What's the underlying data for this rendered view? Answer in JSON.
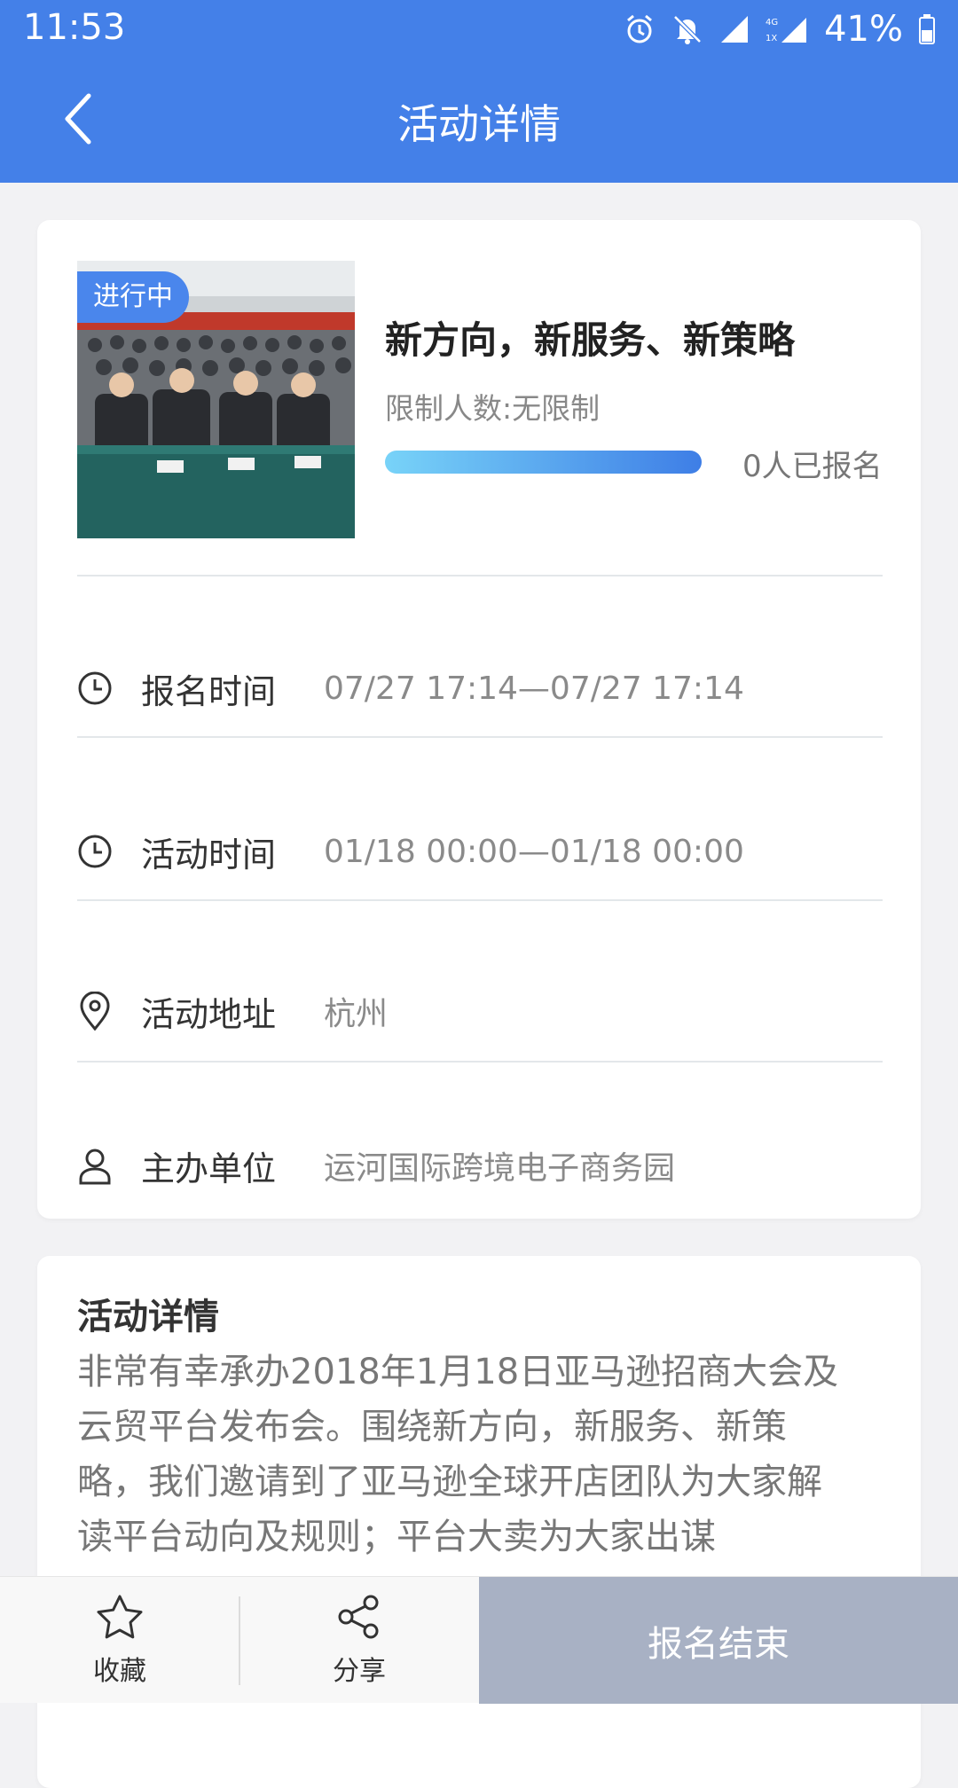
{
  "status_bar": {
    "time": "11:53",
    "battery": "41%",
    "icons": [
      "alarm-icon",
      "mute-icon",
      "signal-icon",
      "4g-signal-icon",
      "battery-icon"
    ]
  },
  "nav": {
    "back_icon": "chevron-left-icon",
    "title": "活动详情"
  },
  "event": {
    "status_tag": "进行中",
    "title": "新方向，新服务、新策略",
    "limit": "限制人数:无限制",
    "signed_up": "0人已报名",
    "progress": 1.0,
    "progress_colors": [
      "#78d3f8",
      "#3e7ee6"
    ]
  },
  "info_rows": [
    {
      "icon": "clock-icon",
      "label": "报名时间",
      "value": "07/27 17:14—07/27 17:14"
    },
    {
      "icon": "clock-icon",
      "label": "活动时间",
      "value": "01/18 00:00—01/18 00:00"
    },
    {
      "icon": "location-pin-icon",
      "label": "活动地址",
      "value": "杭州"
    },
    {
      "icon": "person-icon",
      "label": "主办单位",
      "value": "运河国际跨境电子商务园"
    }
  ],
  "details": {
    "title": "活动详情",
    "text": "非常有幸承办2018年1月18日亚马逊招商大会及云贸平台发布会。围绕新方向，新服务、新策略，我们邀请到了亚马逊全球开店团队为大家解读平台动向及规则；平台大卖为大家出谋"
  },
  "bottom_bar": {
    "favorite_label": "收藏",
    "share_label": "分享",
    "action_label": "报名结束"
  },
  "colors": {
    "header": "#4480e8",
    "tag": "#4a86ec",
    "action_disabled": "#a8b1c4"
  }
}
